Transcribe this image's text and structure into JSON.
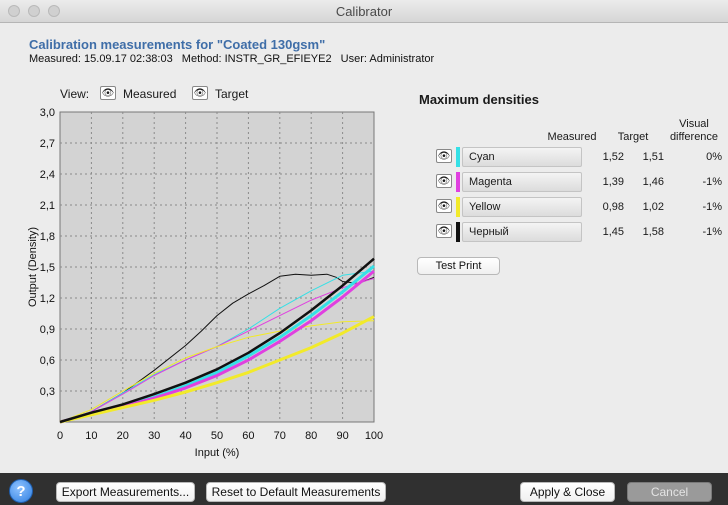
{
  "window": {
    "title": "Calibrator"
  },
  "header": {
    "title": "Calibration measurements for \"Coated 130gsm\"",
    "measured": "Measured: 15.09.17 02:38:03",
    "method": "Method: INSTR_GR_EFIEYE2",
    "user": "User: Administrator"
  },
  "view": {
    "label": "View:",
    "measured": "Measured",
    "target": "Target"
  },
  "chart_data": {
    "type": "line",
    "xlabel": "Input (%)",
    "ylabel": "Output (Density)",
    "xlim": [
      0,
      100
    ],
    "ylim": [
      0,
      3.0
    ],
    "x_ticks": [
      "0",
      "10",
      "20",
      "30",
      "40",
      "50",
      "60",
      "70",
      "80",
      "90",
      "100"
    ],
    "y_ticks": [
      "0,3",
      "0,6",
      "0,9",
      "1,2",
      "1,5",
      "1,8",
      "2,1",
      "2,4",
      "2,7",
      "3,0"
    ],
    "grid": true,
    "series": [
      {
        "name": "Черный (measured)",
        "color": "#111111",
        "width": 1,
        "x": [
          0,
          10,
          20,
          30,
          40,
          45,
          50,
          55,
          60,
          65,
          70,
          75,
          80,
          85,
          88,
          90,
          95,
          100
        ],
        "y": [
          0,
          0.1,
          0.28,
          0.5,
          0.74,
          0.88,
          1.03,
          1.15,
          1.24,
          1.32,
          1.41,
          1.43,
          1.42,
          1.43,
          1.4,
          1.36,
          1.34,
          1.4
        ]
      },
      {
        "name": "Cyan (measured)",
        "color": "#35e0e6",
        "width": 1,
        "x": [
          0,
          10,
          20,
          30,
          40,
          50,
          60,
          70,
          80,
          90,
          100
        ],
        "y": [
          0,
          0.1,
          0.28,
          0.46,
          0.6,
          0.73,
          0.9,
          1.1,
          1.27,
          1.42,
          1.46
        ]
      },
      {
        "name": "Magenta (measured)",
        "color": "#e040e0",
        "width": 1,
        "x": [
          0,
          10,
          20,
          30,
          40,
          50,
          60,
          70,
          80,
          90,
          100
        ],
        "y": [
          0,
          0.1,
          0.27,
          0.45,
          0.6,
          0.73,
          0.88,
          1.03,
          1.18,
          1.3,
          1.39
        ]
      },
      {
        "name": "Yellow (measured)",
        "color": "#f2ea2a",
        "width": 1,
        "x": [
          0,
          10,
          20,
          30,
          40,
          50,
          60,
          70,
          80,
          90,
          100
        ],
        "y": [
          0,
          0.12,
          0.3,
          0.47,
          0.62,
          0.73,
          0.82,
          0.88,
          0.93,
          0.97,
          0.98
        ]
      },
      {
        "name": "Cyan (target)",
        "color": "#35e0e6",
        "width": 3,
        "x": [
          0,
          10,
          20,
          30,
          40,
          50,
          60,
          70,
          80,
          90,
          100
        ],
        "y": [
          0,
          0.08,
          0.15,
          0.24,
          0.35,
          0.48,
          0.64,
          0.82,
          1.03,
          1.26,
          1.51
        ]
      },
      {
        "name": "Magenta (target)",
        "color": "#e040e0",
        "width": 3,
        "x": [
          0,
          10,
          20,
          30,
          40,
          50,
          60,
          70,
          80,
          90,
          100
        ],
        "y": [
          0,
          0.08,
          0.15,
          0.23,
          0.33,
          0.45,
          0.6,
          0.78,
          0.98,
          1.21,
          1.46
        ]
      },
      {
        "name": "Yellow (target)",
        "color": "#f2ea2a",
        "width": 3,
        "x": [
          0,
          10,
          20,
          30,
          40,
          50,
          60,
          70,
          80,
          90,
          100
        ],
        "y": [
          0,
          0.07,
          0.14,
          0.21,
          0.29,
          0.38,
          0.48,
          0.6,
          0.72,
          0.86,
          1.02
        ]
      },
      {
        "name": "Черный (target)",
        "color": "#111111",
        "width": 2.5,
        "x": [
          0,
          10,
          20,
          30,
          40,
          50,
          60,
          70,
          80,
          90,
          100
        ],
        "y": [
          0,
          0.09,
          0.17,
          0.27,
          0.38,
          0.51,
          0.67,
          0.86,
          1.08,
          1.32,
          1.58
        ]
      }
    ]
  },
  "densities": {
    "title": "Maximum densities",
    "col_measured": "Measured",
    "col_target": "Target",
    "col_visual_1": "Visual",
    "col_visual_2": "difference",
    "rows": [
      {
        "name": "Cyan",
        "color": "#35e0e6",
        "measured": "1,52",
        "target": "1,51",
        "diff": "0%"
      },
      {
        "name": "Magenta",
        "color": "#e040e0",
        "measured": "1,39",
        "target": "1,46",
        "diff": "-1%"
      },
      {
        "name": "Yellow",
        "color": "#f2ea2a",
        "measured": "0,98",
        "target": "1,02",
        "diff": "-1%"
      },
      {
        "name": "Черный",
        "color": "#111111",
        "measured": "1,45",
        "target": "1,58",
        "diff": "-1%"
      }
    ],
    "test_print": "Test Print"
  },
  "footer": {
    "help": "?",
    "export": "Export Measurements...",
    "reset": "Reset to Default Measurements",
    "apply": "Apply & Close",
    "cancel": "Cancel"
  },
  "icons": {
    "eye": "eye-icon",
    "help": "help-icon"
  }
}
